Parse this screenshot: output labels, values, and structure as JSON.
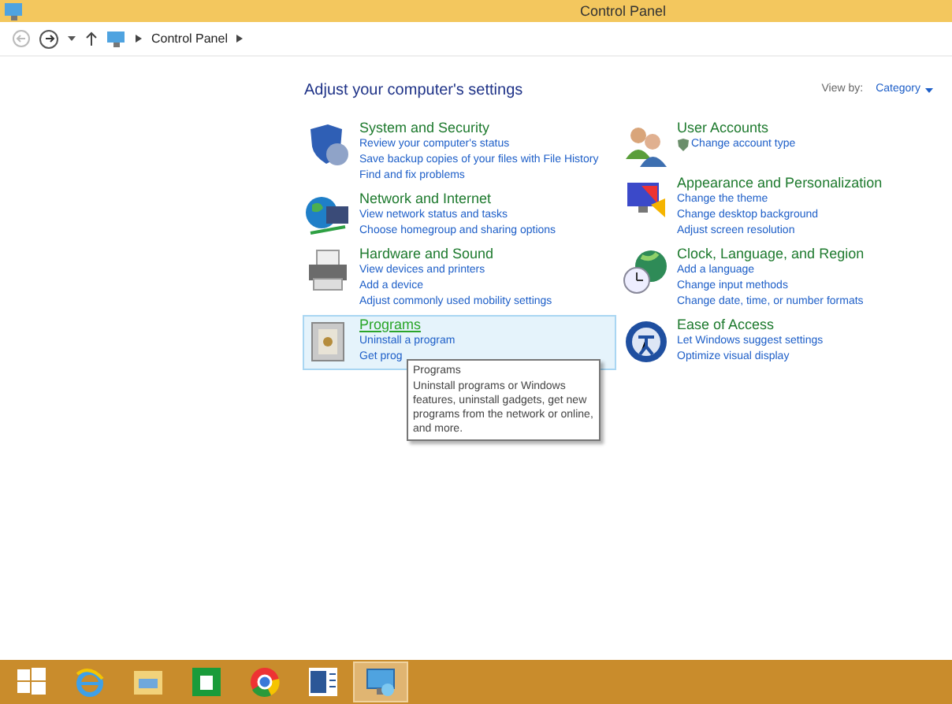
{
  "window": {
    "title": "Control Panel"
  },
  "address_bar": {
    "path": [
      "Control Panel"
    ]
  },
  "heading": "Adjust your computer's settings",
  "view_by": {
    "label": "View by:",
    "value": "Category"
  },
  "columns": [
    {
      "categories": [
        {
          "title": "System and Security",
          "hovered": false,
          "links": [
            "Review your computer's status",
            "Save backup copies of your files with File History",
            "Find and fix problems"
          ]
        },
        {
          "title": "Network and Internet",
          "hovered": false,
          "links": [
            "View network status and tasks",
            "Choose homegroup and sharing options"
          ]
        },
        {
          "title": "Hardware and Sound",
          "hovered": false,
          "links": [
            "View devices and printers",
            "Add a device",
            "Adjust commonly used mobility settings"
          ]
        },
        {
          "title": "Programs",
          "hovered": true,
          "links": [
            "Uninstall a program",
            "Get prog"
          ]
        }
      ]
    },
    {
      "categories": [
        {
          "title": "User Accounts",
          "hovered": false,
          "links": [
            "Change account type"
          ]
        },
        {
          "title": "Appearance and Personalization",
          "hovered": false,
          "links": [
            "Change the theme",
            "Change desktop background",
            "Adjust screen resolution"
          ]
        },
        {
          "title": "Clock, Language, and Region",
          "hovered": false,
          "links": [
            "Add a language",
            "Change input methods",
            "Change date, time, or number formats"
          ]
        },
        {
          "title": "Ease of Access",
          "hovered": false,
          "links": [
            "Let Windows suggest settings",
            "Optimize visual display"
          ]
        }
      ]
    }
  ],
  "tooltip": {
    "title": "Programs",
    "text": "Uninstall programs or Windows features, uninstall gadgets, get new programs from the network or online, and more."
  },
  "taskbar": {
    "items": [
      {
        "selected": false
      },
      {
        "selected": false
      },
      {
        "selected": false
      },
      {
        "selected": false
      },
      {
        "selected": false
      },
      {
        "selected": false
      },
      {
        "selected": true
      }
    ]
  }
}
